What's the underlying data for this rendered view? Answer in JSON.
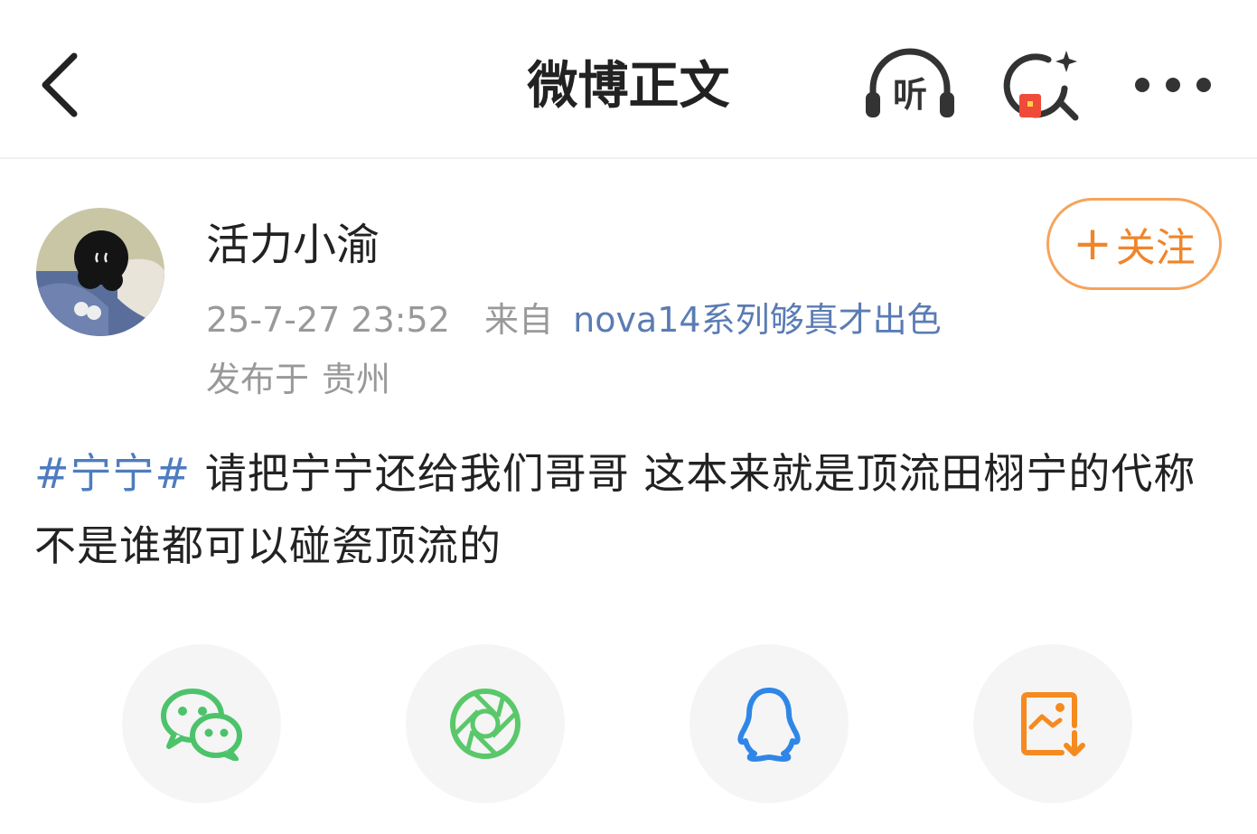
{
  "header": {
    "title": "微博正文",
    "listen_label": "听"
  },
  "post": {
    "author": "活力小渝",
    "timestamp": "25-7-27 23:52",
    "source_prefix": "来自",
    "source": "nova14系列够真才出色",
    "location_prefix": "发布于",
    "location": "贵州",
    "follow_label": "关注",
    "follow_plus": "+",
    "topic": "#宁宁#",
    "text": " 请把宁宁还给我们哥哥 这本来就是顶流田栩宁的代称 不是谁都可以碰瓷顶流的"
  },
  "share": [
    {
      "icon": "wechat-icon",
      "color": "#4cc36b"
    },
    {
      "icon": "moments-icon",
      "color": "#5ac86a"
    },
    {
      "icon": "qq-icon",
      "color": "#2f86e8"
    },
    {
      "icon": "save-image-icon",
      "color": "#f58a1f"
    }
  ],
  "colors": {
    "accent_orange": "#f0852b",
    "link_blue": "#4e7cbf",
    "meta_gray": "#999999"
  }
}
